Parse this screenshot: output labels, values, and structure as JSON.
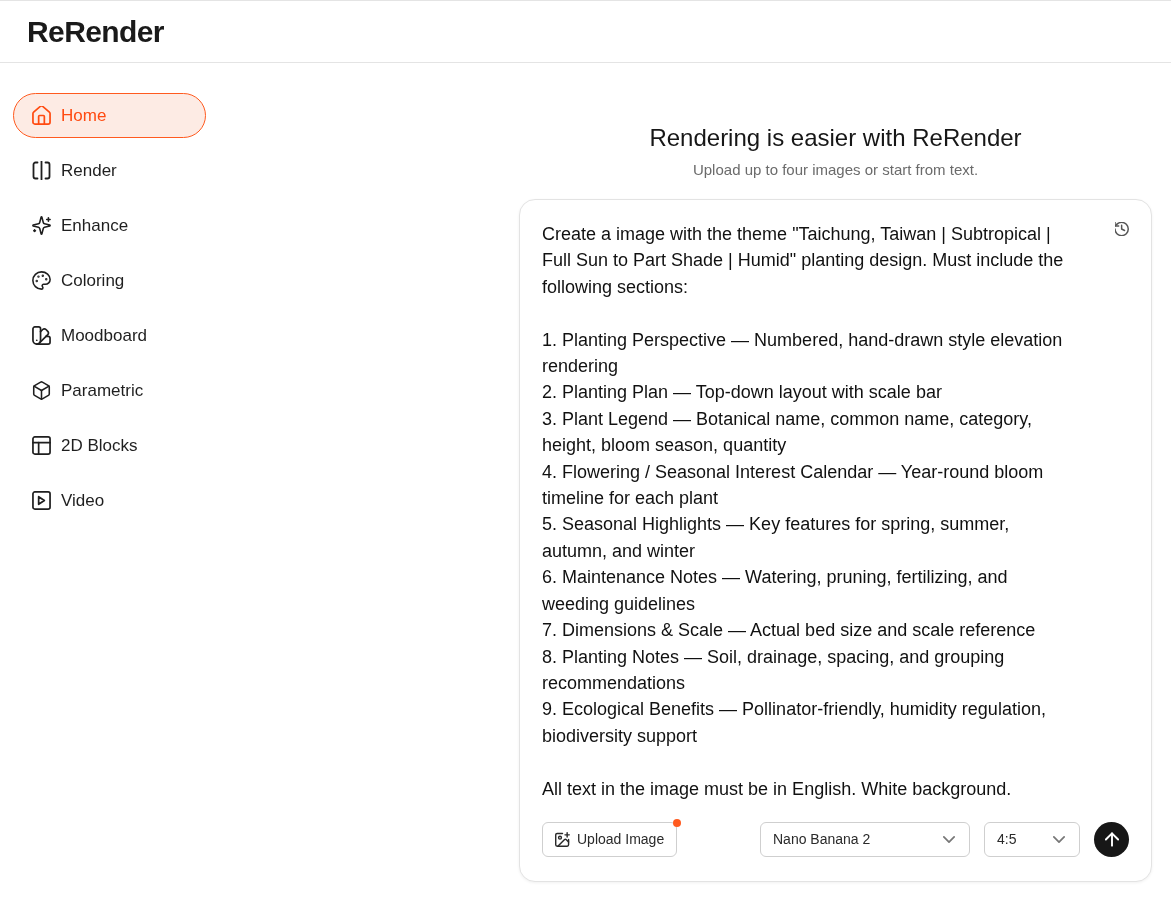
{
  "app": {
    "logo": "ReRender"
  },
  "sidebar": {
    "items": [
      {
        "label": "Home",
        "selected": true
      },
      {
        "label": "Render",
        "selected": false
      },
      {
        "label": "Enhance",
        "selected": false
      },
      {
        "label": "Coloring",
        "selected": false
      },
      {
        "label": "Moodboard",
        "selected": false
      },
      {
        "label": "Parametric",
        "selected": false
      },
      {
        "label": "2D Blocks",
        "selected": false
      },
      {
        "label": "Video",
        "selected": false
      }
    ]
  },
  "hero": {
    "title": "Rendering is easier with ReRender",
    "subtitle": "Upload up to four images or start from text."
  },
  "prompt": {
    "value": "Create a image with the theme \"Taichung, Taiwan | Subtropical | Full Sun to Part Shade | Humid\" planting design. Must include the following sections:\n\n1. Planting Perspective — Numbered, hand-drawn style elevation rendering\n2. Planting Plan — Top-down layout with scale bar\n3. Plant Legend — Botanical name, common name, category, height, bloom season, quantity\n4. Flowering / Seasonal Interest Calendar — Year-round bloom timeline for each plant\n5. Seasonal Highlights — Key features for spring, summer, autumn, and winter\n6. Maintenance Notes — Watering, pruning, fertilizing, and weeding guidelines\n7. Dimensions & Scale — Actual bed size and scale reference\n8. Planting Notes — Soil, drainage, spacing, and grouping recommendations\n9. Ecological Benefits — Pollinator-friendly, humidity regulation, biodiversity support\n\nAll text in the image must be in English. White background."
  },
  "toolbar": {
    "upload_button": {
      "label": "Upload Image",
      "badge_dot": true
    },
    "model_select": {
      "value": "Nano Banana 2"
    },
    "ratio_select": {
      "value": "4:5"
    }
  }
}
